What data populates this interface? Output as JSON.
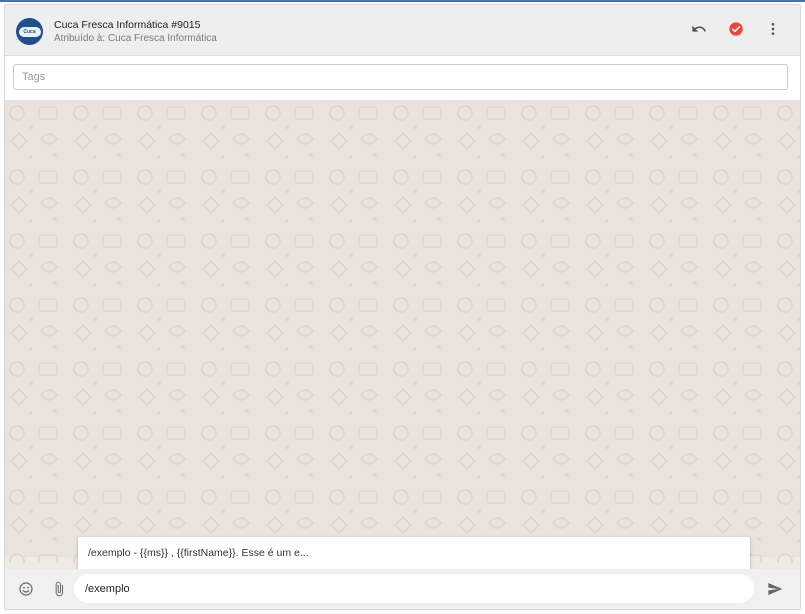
{
  "header": {
    "title": "Cuca Fresca Informática #9015",
    "subtitle": "Atribuído à: Cuca Fresca Informática",
    "avatar_text": "Cuca Fresca",
    "icons": [
      "undo-icon",
      "check-circle-icon",
      "more-vert-icon"
    ],
    "check_color": "#f44336"
  },
  "tags": {
    "placeholder": "Tags"
  },
  "suggestion": {
    "text": "/exemplo - {{ms}} , {{firstName}}. Esse é um e..."
  },
  "composer": {
    "value": "/exemplo",
    "icons": [
      "emoji-icon",
      "attach-icon",
      "send-icon"
    ]
  },
  "colors": {
    "accent_line": "#3f6fc4",
    "chat_background": "#e9e3dc"
  }
}
